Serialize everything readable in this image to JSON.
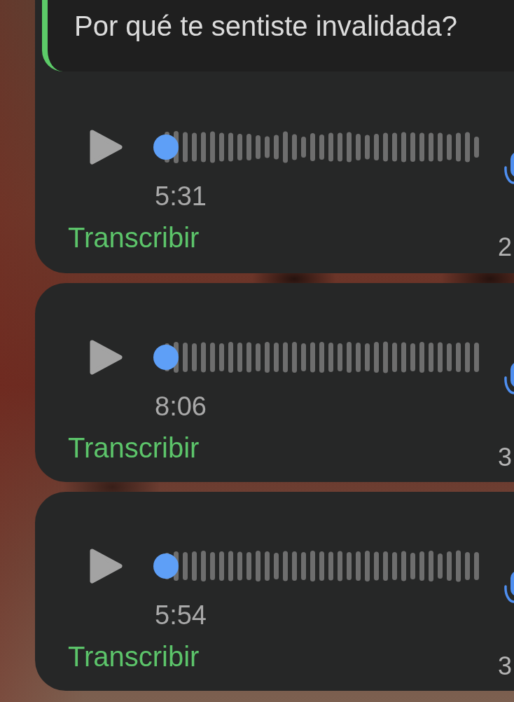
{
  "voice_messages": [
    {
      "quote": "Por qué te sentiste invalidada?",
      "level": 0,
      "duration": "5:31",
      "transcribe_label": "Transcribir",
      "cut_off_text": "2"
    },
    {
      "level": 0,
      "duration": "8:06",
      "transcribe_label": "Transcribir",
      "cut_off_text": "3"
    },
    {
      "level": 0,
      "duration": "5:54",
      "transcribe_label": "Transcribir",
      "cut_off_text": "3"
    }
  ]
}
